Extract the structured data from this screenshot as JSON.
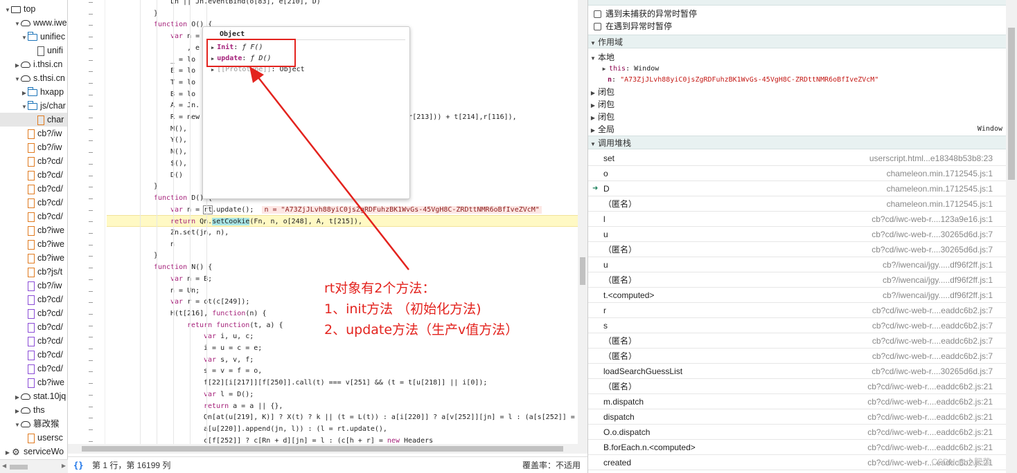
{
  "tree": {
    "items": [
      {
        "label": "top",
        "indent": 0,
        "toggle": "▼",
        "icon": "top"
      },
      {
        "label": "www.iwe",
        "indent": 1,
        "toggle": "▼",
        "icon": "cloud"
      },
      {
        "label": "unifiec",
        "indent": 2,
        "toggle": "▼",
        "icon": "folder"
      },
      {
        "label": "unifi",
        "indent": 3,
        "toggle": "",
        "icon": "file"
      },
      {
        "label": "i.thsi.cn",
        "indent": 1,
        "toggle": "▶",
        "icon": "cloud"
      },
      {
        "label": "s.thsi.cn",
        "indent": 1,
        "toggle": "▼",
        "icon": "cloud"
      },
      {
        "label": "hxapp",
        "indent": 2,
        "toggle": "▶",
        "icon": "folder"
      },
      {
        "label": "js/char",
        "indent": 2,
        "toggle": "▼",
        "icon": "folder"
      },
      {
        "label": "char",
        "indent": 3,
        "toggle": "",
        "icon": "file-o",
        "selected": true
      },
      {
        "label": "cb?/iw",
        "indent": 2,
        "toggle": "",
        "icon": "file-o"
      },
      {
        "label": "cb?/iw",
        "indent": 2,
        "toggle": "",
        "icon": "file-o"
      },
      {
        "label": "cb?cd/",
        "indent": 2,
        "toggle": "",
        "icon": "file-o"
      },
      {
        "label": "cb?cd/",
        "indent": 2,
        "toggle": "",
        "icon": "file-o"
      },
      {
        "label": "cb?cd/",
        "indent": 2,
        "toggle": "",
        "icon": "file-o"
      },
      {
        "label": "cb?cd/",
        "indent": 2,
        "toggle": "",
        "icon": "file-o"
      },
      {
        "label": "cb?cd/",
        "indent": 2,
        "toggle": "",
        "icon": "file-o"
      },
      {
        "label": "cb?iwe",
        "indent": 2,
        "toggle": "",
        "icon": "file-o"
      },
      {
        "label": "cb?iwe",
        "indent": 2,
        "toggle": "",
        "icon": "file-o"
      },
      {
        "label": "cb?iwe",
        "indent": 2,
        "toggle": "",
        "icon": "file-o"
      },
      {
        "label": "cb?js/t",
        "indent": 2,
        "toggle": "",
        "icon": "file-o"
      },
      {
        "label": "cb?/iw",
        "indent": 2,
        "toggle": "",
        "icon": "file-p"
      },
      {
        "label": "cb?cd/",
        "indent": 2,
        "toggle": "",
        "icon": "file-p"
      },
      {
        "label": "cb?cd/",
        "indent": 2,
        "toggle": "",
        "icon": "file-p"
      },
      {
        "label": "cb?cd/",
        "indent": 2,
        "toggle": "",
        "icon": "file-p"
      },
      {
        "label": "cb?cd/",
        "indent": 2,
        "toggle": "",
        "icon": "file-p"
      },
      {
        "label": "cb?cd/",
        "indent": 2,
        "toggle": "",
        "icon": "file-p"
      },
      {
        "label": "cb?cd/",
        "indent": 2,
        "toggle": "",
        "icon": "file-p"
      },
      {
        "label": "cb?iwe",
        "indent": 2,
        "toggle": "",
        "icon": "file-p"
      },
      {
        "label": "stat.10jq",
        "indent": 1,
        "toggle": "▶",
        "icon": "cloud"
      },
      {
        "label": "ths",
        "indent": 1,
        "toggle": "▶",
        "icon": "cloud"
      },
      {
        "label": "篡改猴",
        "indent": 1,
        "toggle": "▼",
        "icon": "cloud"
      },
      {
        "label": "usersc",
        "indent": 2,
        "toggle": "",
        "icon": "file-o"
      },
      {
        "label": "serviceWo",
        "indent": 0,
        "toggle": "▶",
        "icon": "gear"
      }
    ]
  },
  "code": {
    "lines": [
      {
        "indent": 3,
        "html": "Ln || Jn.eventBind(o[83], e[210], D)"
      },
      {
        "indent": 2,
        "html": "}"
      },
      {
        "indent": 2,
        "html": "<span class='kw'>function</span> O() {"
      },
      {
        "indent": 3,
        "html": "<span class='kw'>var</span> n ="
      },
      {
        "indent": 4,
        "html": ", e"
      },
      {
        "indent": 3,
        "html": "_ = lo"
      },
      {
        "indent": 3,
        "html": "E = lo"
      },
      {
        "indent": 3,
        "html": "T = lo"
      },
      {
        "indent": 3,
        "html": "B = lo"
      },
      {
        "indent": 3,
        "html": "A = Jn."
      },
      {
        "indent": 3,
        "html": "R = new                                       ot(c[247], r[213])) + t[214],r[116]),"
      },
      {
        "indent": 3,
        "html": "M(),"
      },
      {
        "indent": 3,
        "html": "Y(),"
      },
      {
        "indent": 3,
        "html": "N(),"
      },
      {
        "indent": 3,
        "html": "$(),"
      },
      {
        "indent": 3,
        "html": "D()"
      },
      {
        "indent": 2,
        "html": "}"
      },
      {
        "indent": 2,
        "html": "<span class='kw'>function</span> D() {"
      },
      {
        "indent": 3,
        "html": "<span class='kw'>var</span> n = <span class='rt-box'>rt</span>.update();  <span class='inline-val'>n = \"A73ZjJLvh88yiC0jsZgRDFuhzBK1WvGs-45VgH8C-ZRDttNMR6oBfIveZVcM\"</span>"
      },
      {
        "indent": 3,
        "html": "<span class='kw'>return</span> Qn.<span class='setc'>setCookie</span>(Fn, n, o[248], A, t[215]),",
        "highlight": true
      },
      {
        "indent": 3,
        "html": "Zn.set(jn, n),"
      },
      {
        "indent": 3,
        "html": "n"
      },
      {
        "indent": 2,
        "html": "}"
      },
      {
        "indent": 2,
        "html": "<span class='kw'>function</span> N() {"
      },
      {
        "indent": 3,
        "html": "<span class='kw'>var</span> n = B;"
      },
      {
        "indent": 3,
        "html": "n = Un;"
      },
      {
        "indent": 3,
        "html": "<span class='kw'>var</span> r = ot(c[249]);"
      },
      {
        "indent": 3,
        "html": "H(t[216], <span class='kw'>function</span>(n) {"
      },
      {
        "indent": 4,
        "html": "<span class='kw'>return function</span>(t, a) {"
      },
      {
        "indent": 5,
        "html": "<span class='kw'>var</span> i, u, c;"
      },
      {
        "indent": 5,
        "html": "i = u = c = e;"
      },
      {
        "indent": 5,
        "html": "<span class='kw'>var</span> s, v, f;"
      },
      {
        "indent": 5,
        "html": "s = v = f = o,"
      },
      {
        "indent": 5,
        "html": "f[22][i[217]][f[250]].call(t) === v[251] && (t = t[u[218]] || i[0]);"
      },
      {
        "indent": 5,
        "html": "<span class='kw'>var</span> l = D();"
      },
      {
        "indent": 5,
        "html": "<span class='kw'>return</span> a = a || {},"
      },
      {
        "indent": 5,
        "html": "Qn[at(u[219], K)] ? X(t) ? k || (t = L(t)) : a[i[220]] ? a[v[252]][jn] = l : (a[s[252]] ="
      },
      {
        "indent": 5,
        "html": "a[u[220]].append(jn, l)) : (l = rt.update(),"
      },
      {
        "indent": 5,
        "html": "c[f[252]] ? c[Rn + d][jn] = l : (c[h + r] = <span class='kw'>new</span> Headers"
      }
    ]
  },
  "popup": {
    "title": "Object",
    "rows": [
      {
        "toggle": "▶",
        "key": "Init",
        "sep": ": ",
        "value": "ƒ F()"
      },
      {
        "toggle": "▶",
        "key": "update",
        "sep": ": ",
        "value": "ƒ D()"
      },
      {
        "toggle": "▶",
        "key": "[[Prototype]]",
        "sep": ": ",
        "value": "Object"
      }
    ]
  },
  "status": {
    "braces": "{}",
    "position": "第 1 行，第 16199 列",
    "coverage": "覆盖率：不适用"
  },
  "annotation": {
    "line1": "rt对象有2个方法：",
    "line2": "1、init方法 （初始化方法)",
    "line3": "2、update方法（生产v值方法）",
    "color": "#e3231e"
  },
  "right": {
    "pause_uncaught": "遇到未捕获的异常时暂停",
    "pause_caught": "在遇到异常时暂停",
    "scope_header": "作用域",
    "local": "本地",
    "this_key": "this",
    "this_val": "Window",
    "n_key": "n",
    "n_val": "\"A73ZjJLvh88yiC0jsZgRDFuhzBK1WvGs-45VgH8C-ZRDttNMR6oBfIveZVcM\"",
    "closure1": "闭包",
    "closure2": "闭包",
    "closure3": "闭包",
    "global": "全局",
    "global_val": "Window",
    "callstack_header": "调用堆栈",
    "stack": [
      {
        "fn": "set",
        "loc": "userscript.html...e18348b53b8:23"
      },
      {
        "fn": "o",
        "loc": "chameleon.min.1712545.js:1"
      },
      {
        "fn": "D",
        "loc": "chameleon.min.1712545.js:1",
        "current": true
      },
      {
        "fn": "（匿名）",
        "loc": "chameleon.min.1712545.js:1"
      },
      {
        "fn": "l",
        "loc": "cb?cd/iwc-web-r....123a9e16.js:1"
      },
      {
        "fn": "u",
        "loc": "cb?cd/iwc-web-r....30265d6d.js:7"
      },
      {
        "fn": "（匿名）",
        "loc": "cb?cd/iwc-web-r....30265d6d.js:7"
      },
      {
        "fn": "u",
        "loc": "cb?/iwencai/jgy.....df96f2ff.js:1"
      },
      {
        "fn": "（匿名）",
        "loc": "cb?/iwencai/jgy.....df96f2ff.js:1"
      },
      {
        "fn": "t.<computed>",
        "loc": "cb?/iwencai/jgy.....df96f2ff.js:1"
      },
      {
        "fn": "r",
        "loc": "cb?cd/iwc-web-r....eaddc6b2.js:7"
      },
      {
        "fn": "s",
        "loc": "cb?cd/iwc-web-r....eaddc6b2.js:7"
      },
      {
        "fn": "（匿名）",
        "loc": "cb?cd/iwc-web-r....eaddc6b2.js:7"
      },
      {
        "fn": "（匿名）",
        "loc": "cb?cd/iwc-web-r....eaddc6b2.js:7"
      },
      {
        "fn": "loadSearchGuessList",
        "loc": "cb?cd/iwc-web-r....30265d6d.js:7"
      },
      {
        "fn": "（匿名）",
        "loc": "cb?cd/iwc-web-r....eaddc6b2.js:21"
      },
      {
        "fn": "m.dispatch",
        "loc": "cb?cd/iwc-web-r....eaddc6b2.js:21"
      },
      {
        "fn": "dispatch",
        "loc": "cb?cd/iwc-web-r....eaddc6b2.js:21"
      },
      {
        "fn": "O.o.dispatch",
        "loc": "cb?cd/iwc-web-r....eaddc6b2.js:21"
      },
      {
        "fn": "B.forEach.n.<computed>",
        "loc": "cb?cd/iwc-web-r....eaddc6b2.js:21"
      },
      {
        "fn": "created",
        "loc": "cb?cd/iwc-web-r....eaddc6b2.js:21"
      }
    ],
    "watermark": "CSDN @小肥菜"
  }
}
